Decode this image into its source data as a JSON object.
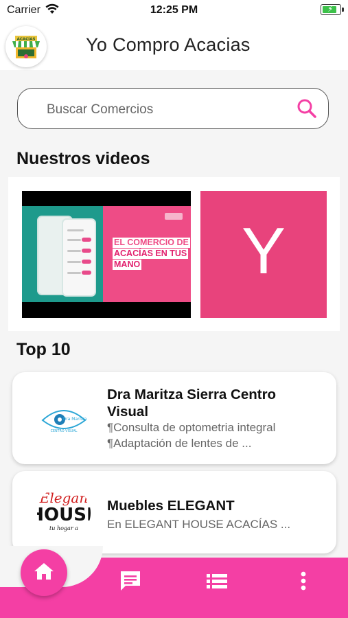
{
  "status_bar": {
    "carrier": "Carrier",
    "time": "12:25 PM"
  },
  "header": {
    "title": "Yo Compro Acacias",
    "logo_text": "ACACÍAS"
  },
  "search": {
    "placeholder": "Buscar Comercios"
  },
  "videos": {
    "section_title": "Nuestros videos",
    "items": [
      {
        "caption_line1": "EL COMERCIO DE",
        "caption_line2": "ACACÍAS EN TUS",
        "caption_line3": "MANO"
      },
      {
        "letter": "Y"
      }
    ]
  },
  "top10": {
    "section_title": "Top 10",
    "items": [
      {
        "title_line1": "Dra Maritza Sierra Centro",
        "title_line2": "Visual",
        "desc_line1": "¶Consulta de optometria integral",
        "desc_line2": "¶Adaptación de lentes de ...",
        "logo_text": "Dra Maritza",
        "logo_sub": "CENTRO VISUAL"
      },
      {
        "title_line1": "Muebles ELEGANT",
        "desc_line1": "En ELEGANT HOUSE ACACÍAS ...",
        "logo_line1": "Elegan",
        "logo_line2": "HOUSE",
        "logo_line3": "tu hogar a"
      }
    ]
  },
  "bottom_nav": {
    "items": [
      {
        "icon": "home-icon"
      },
      {
        "icon": "chat-icon"
      },
      {
        "icon": "list-icon"
      },
      {
        "icon": "more-vertical-icon"
      }
    ]
  },
  "colors": {
    "accent": "#f43fa4",
    "teal": "#1e9a8c",
    "video_pink": "#e8437c"
  }
}
